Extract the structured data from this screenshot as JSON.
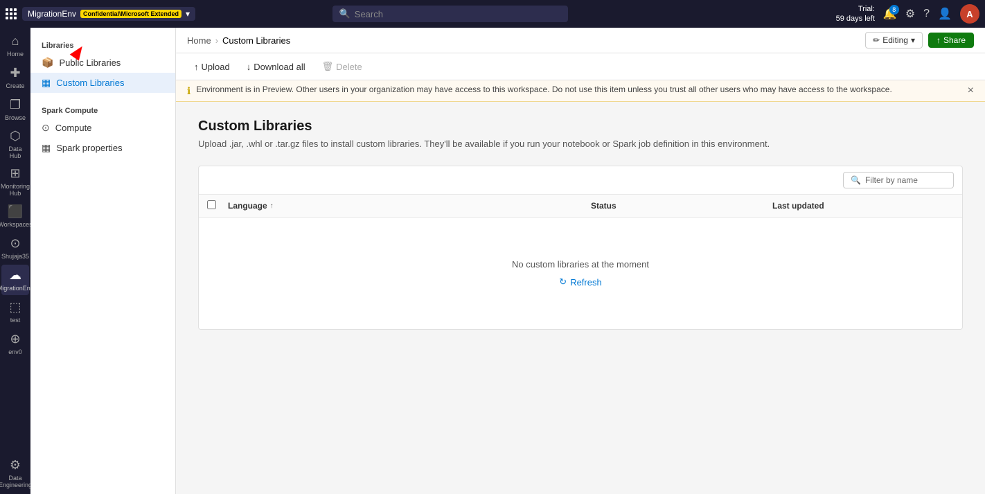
{
  "app": {
    "waffle_label": "Apps",
    "env_name": "MigrationEnv",
    "env_sensitivity": "Confidential\\Microsoft Extended",
    "search_placeholder": "Search",
    "trial_line1": "Trial:",
    "trial_line2": "59 days left",
    "notif_count": "8",
    "avatar_initials": "A"
  },
  "icon_nav": {
    "items": [
      {
        "id": "home",
        "icon": "⌂",
        "label": "Home"
      },
      {
        "id": "create",
        "icon": "✚",
        "label": "Create"
      },
      {
        "id": "browse",
        "icon": "❐",
        "label": "Browse"
      },
      {
        "id": "datahub",
        "icon": "⬡",
        "label": "Data Hub"
      },
      {
        "id": "monitoring",
        "icon": "⊞",
        "label": "Monitoring Hub"
      },
      {
        "id": "workspaces",
        "icon": "⬛",
        "label": "Workspaces"
      },
      {
        "id": "shujaja35",
        "icon": "⊙",
        "label": "Shujaja35"
      },
      {
        "id": "migrationenv",
        "icon": "☁",
        "label": "MigrationEnv"
      },
      {
        "id": "test",
        "icon": "⬚",
        "label": "test"
      },
      {
        "id": "env0",
        "icon": "⊕",
        "label": "env0"
      }
    ],
    "bottom_item": {
      "id": "data-engineering",
      "icon": "⚙",
      "label": "Data Engineering"
    }
  },
  "sidebar": {
    "libraries_section": "Libraries",
    "items": [
      {
        "id": "public-libraries",
        "label": "Public Libraries",
        "icon": "📦",
        "active": false
      },
      {
        "id": "custom-libraries",
        "label": "Custom Libraries",
        "icon": "▦",
        "active": true
      }
    ],
    "spark_compute_section": "Spark Compute",
    "spark_items": [
      {
        "id": "compute",
        "label": "Compute",
        "icon": "⊙",
        "active": false
      },
      {
        "id": "spark-properties",
        "label": "Spark properties",
        "icon": "▦",
        "active": false
      }
    ]
  },
  "breadcrumb": {
    "home_label": "Home",
    "current_label": "Custom Libraries"
  },
  "toolbar": {
    "editing_label": "Editing",
    "share_label": "Share"
  },
  "action_bar": {
    "upload_label": "Upload",
    "download_all_label": "Download all",
    "delete_label": "Delete"
  },
  "warning": {
    "text": "Environment is in Preview. Other users in your organization may have access to this workspace. Do not use this item unless you trust all other users who may have access to the workspace."
  },
  "page": {
    "title": "Custom Libraries",
    "subtitle": "Upload .jar, .whl or .tar.gz files to install custom libraries. They'll be available if you run your notebook or Spark job definition in this environment."
  },
  "table": {
    "filter_placeholder": "Filter by name",
    "columns": {
      "language": "Language",
      "status": "Status",
      "last_updated": "Last updated"
    },
    "empty_message": "No custom libraries at the moment",
    "refresh_label": "Refresh"
  }
}
